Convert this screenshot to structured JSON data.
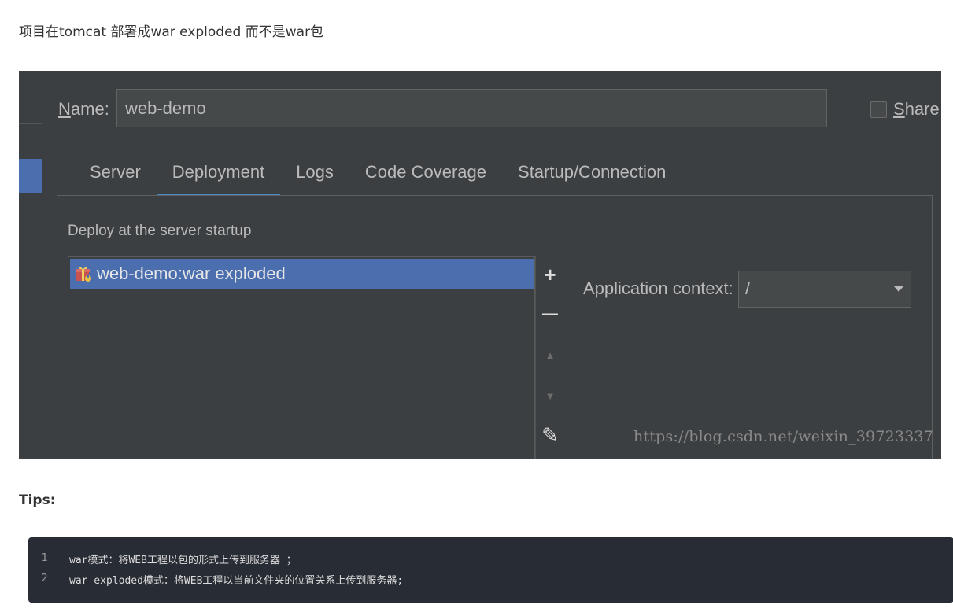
{
  "intro_text": "项目在tomcat 部署成war exploded 而不是war包",
  "dialog": {
    "name_label_prefix": "N",
    "name_label_rest": "ame:",
    "name_value": "web-demo",
    "share_label_prefix": "S",
    "share_label_rest": "hare",
    "share_checked": false,
    "tabs": [
      {
        "label": "Server",
        "active": false
      },
      {
        "label": "Deployment",
        "active": true
      },
      {
        "label": "Logs",
        "active": false
      },
      {
        "label": "Code Coverage",
        "active": false
      },
      {
        "label": "Startup/Connection",
        "active": false
      }
    ],
    "group_title": "Deploy at the server startup",
    "deploy_items": [
      {
        "label": "web-demo:war exploded",
        "icon": "artifact-icon",
        "selected": true
      }
    ],
    "toolbar": [
      {
        "name": "add-icon",
        "glyph": "+"
      },
      {
        "name": "remove-icon",
        "glyph": "—"
      },
      {
        "name": "move-up-icon",
        "glyph": "▲"
      },
      {
        "name": "move-down-icon",
        "glyph": "▼"
      },
      {
        "name": "edit-icon",
        "glyph": "✎"
      }
    ],
    "context_label": "Application context:",
    "context_value": "/",
    "watermark": "https://blog.csdn.net/weixin_39723337"
  },
  "tips_heading": "Tips:",
  "code_lines": [
    {
      "num": "1",
      "text": "war模式：将WEB工程以包的形式上传到服务器 ；"
    },
    {
      "num": "2",
      "text": "war exploded模式：将WEB工程以当前文件夹的位置关系上传到服务器;"
    }
  ],
  "colors": {
    "ide_bg": "#3c3f41",
    "selection": "#4b6eaf",
    "tab_underline": "#4a88c7",
    "code_bg": "#282c34"
  }
}
